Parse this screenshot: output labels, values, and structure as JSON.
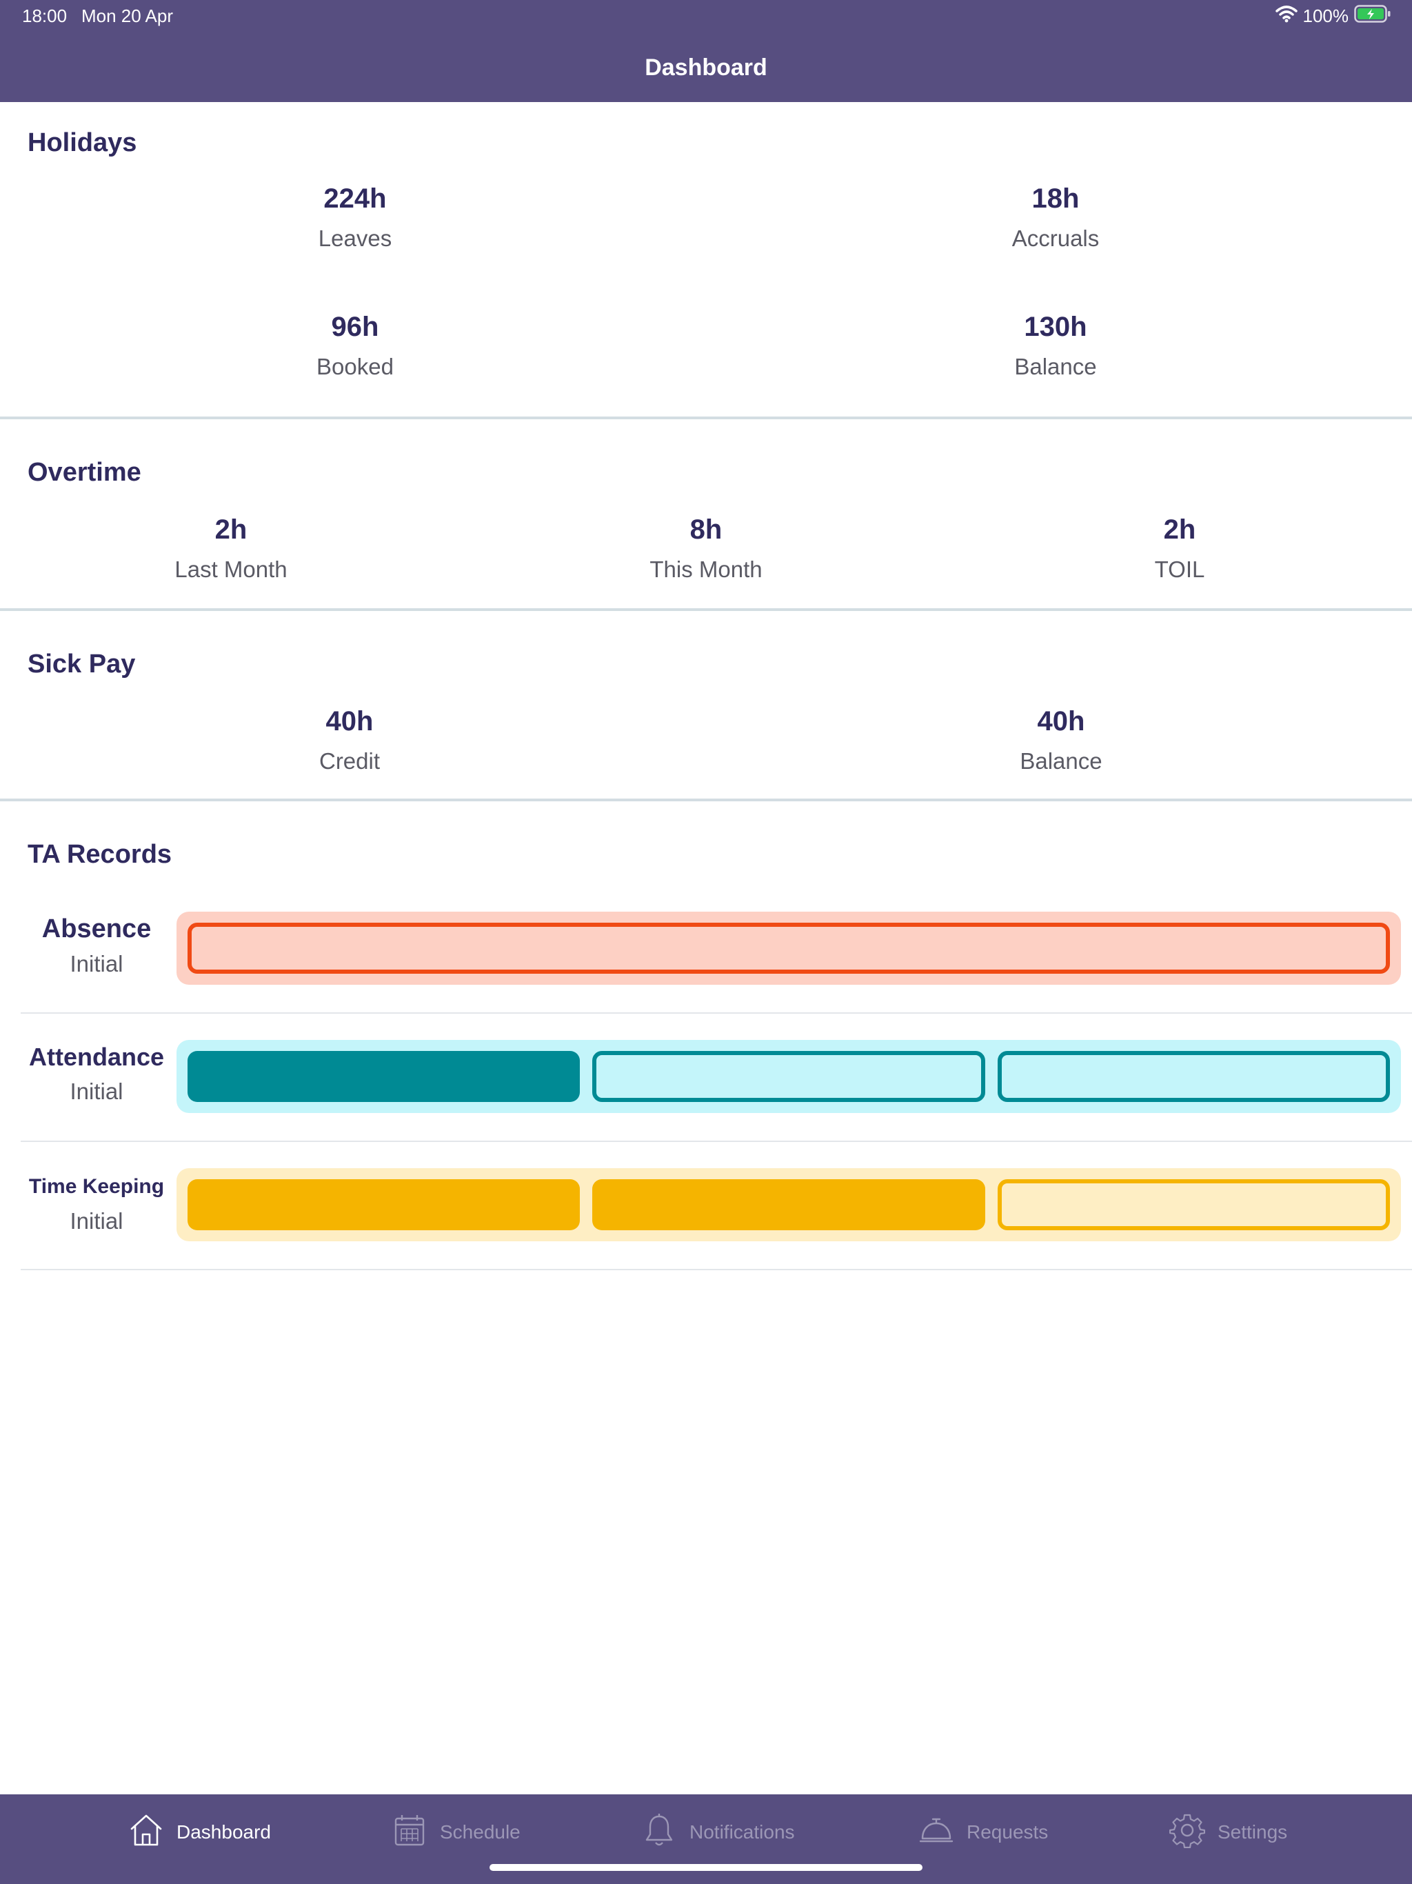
{
  "status_bar": {
    "time": "18:00",
    "date": "Mon 20 Apr",
    "battery": "100%"
  },
  "header": {
    "title": "Dashboard"
  },
  "holidays": {
    "title": "Holidays",
    "stats": [
      {
        "value": "224h",
        "label": "Leaves"
      },
      {
        "value": "18h",
        "label": "Accruals"
      },
      {
        "value": "96h",
        "label": "Booked"
      },
      {
        "value": "130h",
        "label": "Balance"
      }
    ]
  },
  "overtime": {
    "title": "Overtime",
    "stats": [
      {
        "value": "2h",
        "label": "Last Month"
      },
      {
        "value": "8h",
        "label": "This Month"
      },
      {
        "value": "2h",
        "label": "TOIL"
      }
    ]
  },
  "sick_pay": {
    "title": "Sick Pay",
    "stats": [
      {
        "value": "40h",
        "label": "Credit"
      },
      {
        "value": "40h",
        "label": "Balance"
      }
    ]
  },
  "ta_records": {
    "title": "TA Records",
    "rows": [
      {
        "name": "Absence",
        "status": "Initial",
        "colors": {
          "track": "#fdd0c4",
          "fill": "#f04a14",
          "border": "#f04a14"
        },
        "segments_total": 1,
        "segments_filled": 0
      },
      {
        "name": "Attendance",
        "status": "Initial",
        "colors": {
          "track": "#c4f5fa",
          "fill": "#008a94",
          "border": "#008a94"
        },
        "segments_total": 3,
        "segments_filled": 1
      },
      {
        "name": "Time Keeping",
        "status": "Initial",
        "colors": {
          "track": "#feeec4",
          "fill": "#f5b400",
          "border": "#f5b400"
        },
        "segments_total": 3,
        "segments_filled": 2
      }
    ]
  },
  "tab_bar": {
    "active_color": "#ffffff",
    "inactive_color": "#9c97b6",
    "items": [
      {
        "label": "Dashboard",
        "icon": "home-icon",
        "active": true
      },
      {
        "label": "Schedule",
        "icon": "calendar-icon",
        "active": false
      },
      {
        "label": "Notifications",
        "icon": "bell-icon",
        "active": false
      },
      {
        "label": "Requests",
        "icon": "service-bell-icon",
        "active": false
      },
      {
        "label": "Settings",
        "icon": "gear-icon",
        "active": false
      }
    ]
  }
}
